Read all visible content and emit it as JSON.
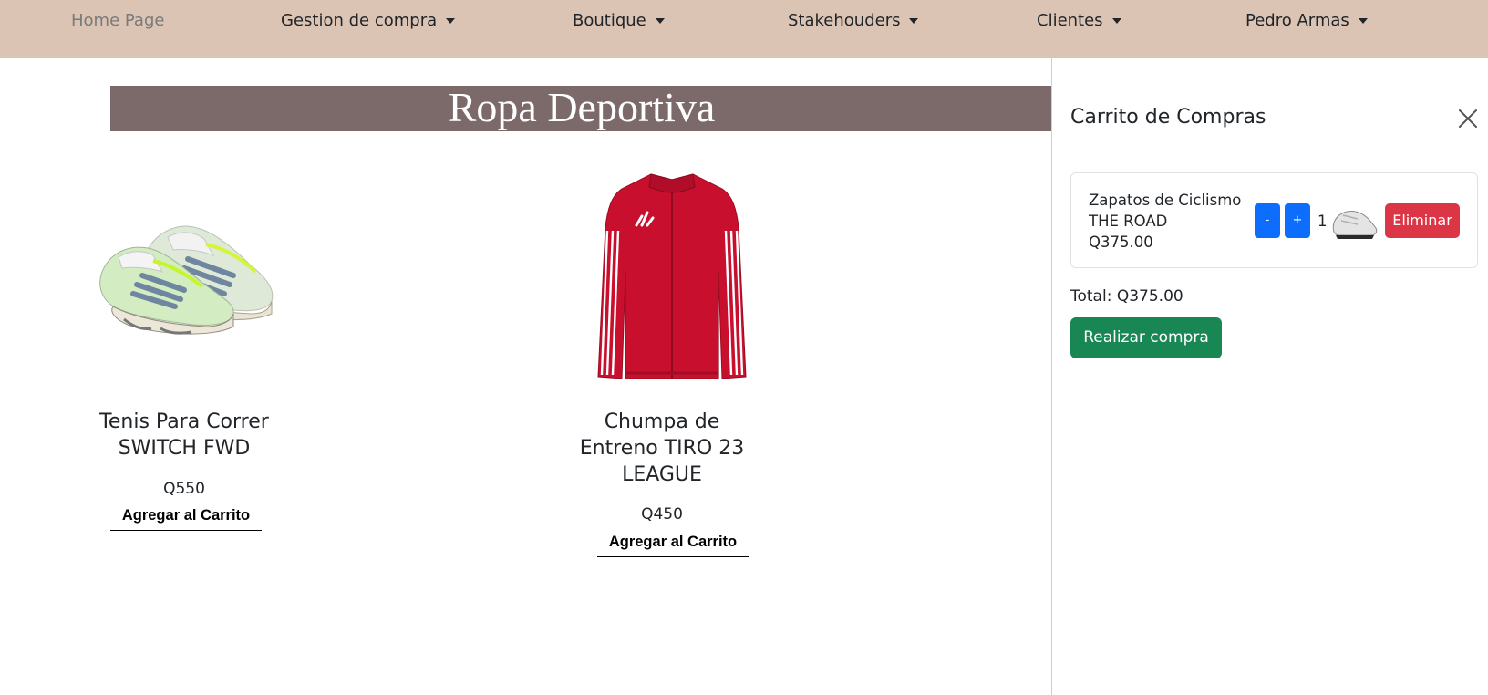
{
  "navbar": {
    "items": [
      {
        "label": "Home Page",
        "dropdown": false
      },
      {
        "label": "Gestion de compra",
        "dropdown": true
      },
      {
        "label": "Boutique",
        "dropdown": true
      },
      {
        "label": "Stakehouders",
        "dropdown": true
      },
      {
        "label": "Clientes",
        "dropdown": true
      },
      {
        "label": "Pedro Armas",
        "dropdown": true
      }
    ]
  },
  "catalog": {
    "banner_title": "Ropa Deportiva",
    "products": [
      {
        "name": "Tenis Para Correr SWITCH FWD",
        "price": "Q550",
        "button_label": "Agregar al Carrito",
        "image_icon": "running-shoes-image"
      },
      {
        "name": "Chumpa de Entreno TIRO 23 LEAGUE",
        "price": "Q450",
        "button_label": "Agregar al Carrito",
        "image_icon": "red-track-jacket-image"
      }
    ]
  },
  "cart": {
    "title": "Carrito de Compras",
    "close_icon": "close-icon",
    "items": [
      {
        "name": "Zapatos de Ciclismo THE ROAD",
        "price": "Q375.00",
        "minus_label": "-",
        "plus_label": "+",
        "quantity": "1",
        "image_icon": "cycling-shoe-thumbnail",
        "remove_label": "Eliminar"
      }
    ],
    "total_label": "Total: Q375.00",
    "checkout_label": "Realizar compra"
  },
  "colors": {
    "navbar_bg": "#dcc4b4",
    "banner_bg": "#7b6a69",
    "primary_blue": "#0d6efd",
    "danger_red": "#dc3545",
    "success_green": "#198754"
  }
}
